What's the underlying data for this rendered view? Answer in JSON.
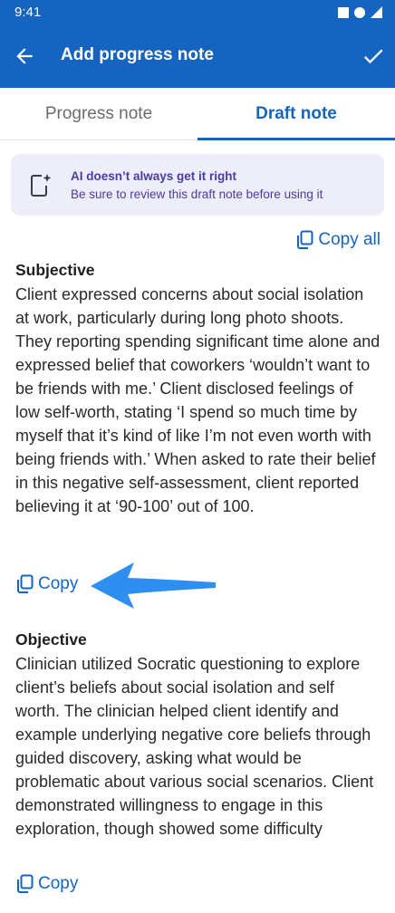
{
  "status_bar": {
    "time": "9:41"
  },
  "app_bar": {
    "title": "Add progress note"
  },
  "tabs": [
    {
      "label": "Progress note",
      "active": false
    },
    {
      "label": "Draft note",
      "active": true
    }
  ],
  "banner": {
    "title": "AI doesn’t always get it right",
    "subtitle": "Be sure to review this draft note before using it"
  },
  "copy_all_label": "Copy all",
  "sections": [
    {
      "heading": "Subjective",
      "body": "Client expressed concerns about social isolation at work, particularly during long photo shoots. They reporting spending significant time alone and expressed belief that coworkers ‘wouldn’t want to be friends with me.’ Client disclosed feelings of low self-worth, stating ‘I spend so much time by myself that it’s kind of like I’m not even worth with being friends with.’ When asked to rate their belief in this negative self-assessment, client reported believing it at ‘90-100’ out of 100.",
      "copy_label": "Copy"
    },
    {
      "heading": "Objective",
      "body": "Clinician utilized Socratic questioning to explore client’s beliefs about social isolation and self worth. The clinician helped client identify and example underlying negative core beliefs through guided discovery, asking what would be problematic about various social scenarios. Client demonstrated willingness to engage in this exploration, though showed some difficulty",
      "copy_label": "Copy"
    }
  ],
  "colors": {
    "primary": "#1565c0",
    "banner_bg": "#eeedfa",
    "banner_text": "#4a3d9e",
    "arrow": "#2f8ff0"
  }
}
